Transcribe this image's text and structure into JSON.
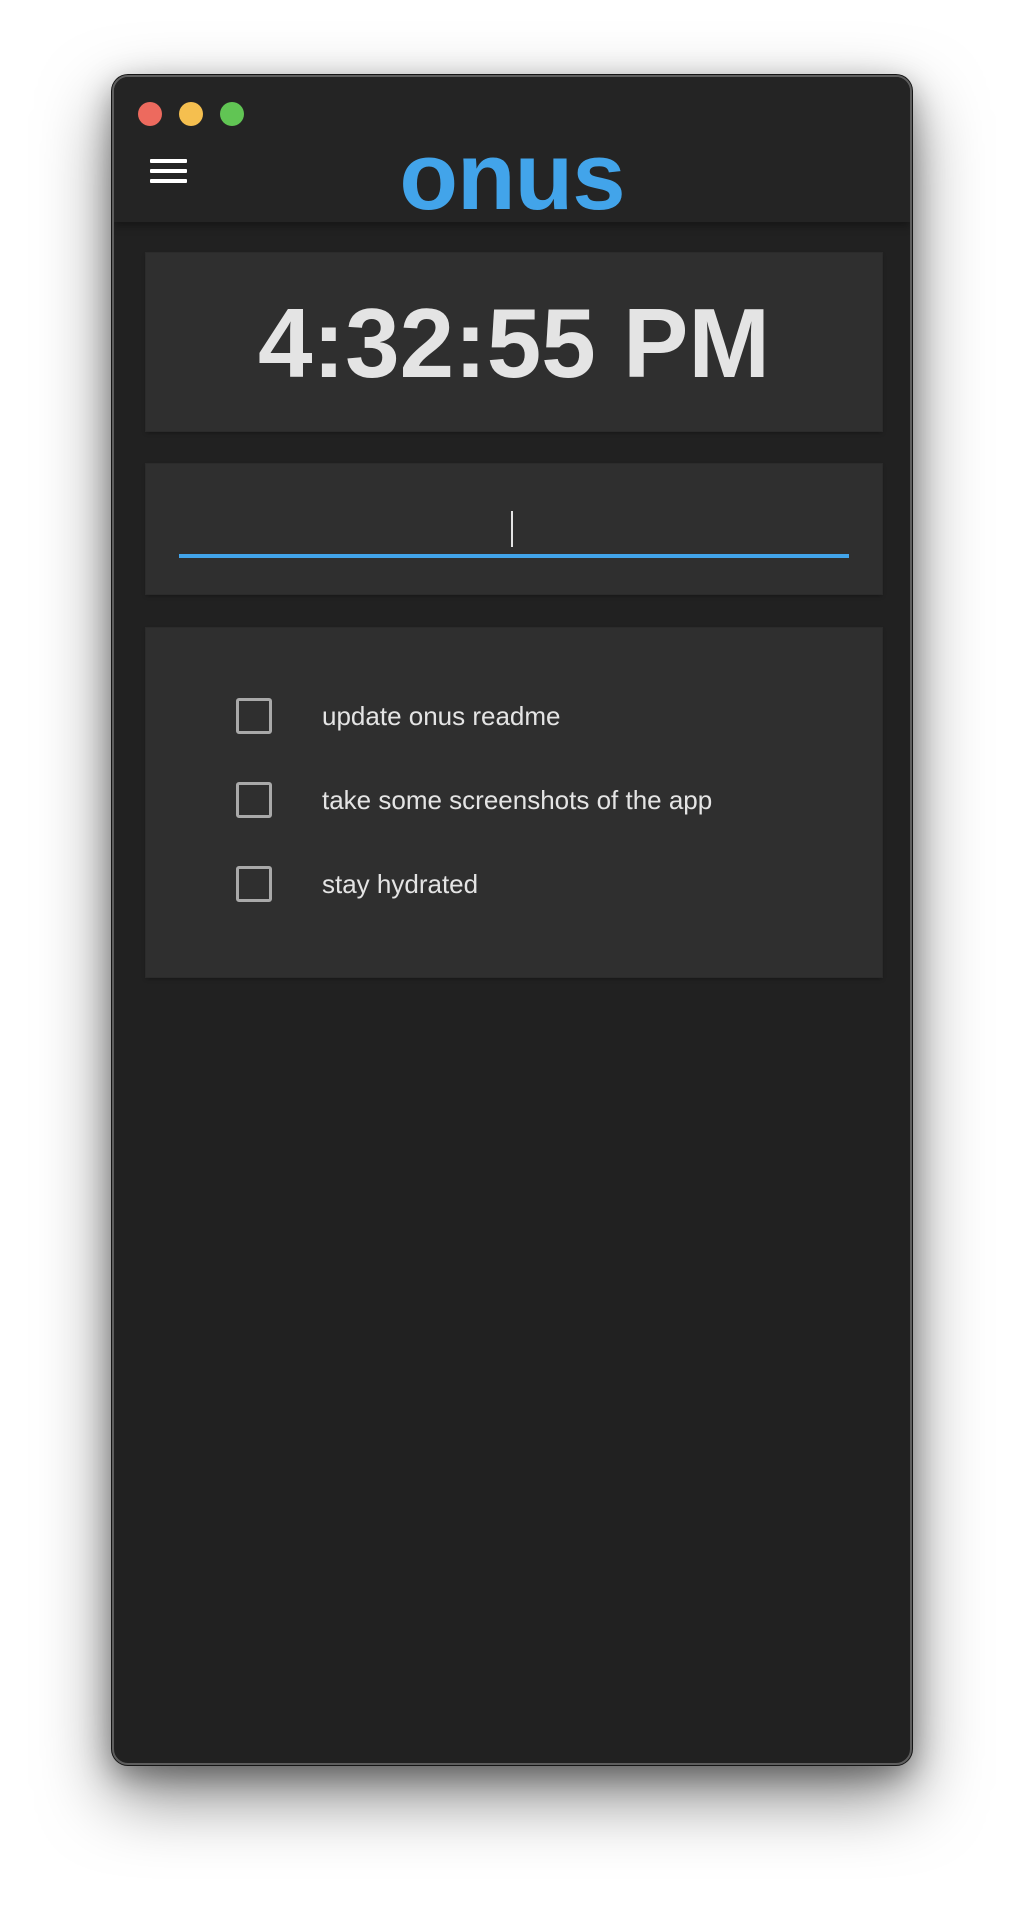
{
  "window": {
    "traffic_lights": {
      "close_color": "#ed6a5e",
      "minimize_color": "#f5bf4f",
      "maximize_color": "#61c554"
    }
  },
  "header": {
    "menu_icon": "hamburger-menu-icon",
    "title": "onus",
    "title_color": "#42a4ea"
  },
  "clock": {
    "time": "4:32:55 PM"
  },
  "task_input": {
    "value": "",
    "placeholder": "",
    "underline_color": "#42a4ea"
  },
  "todos": [
    {
      "label": "update onus readme",
      "checked": false
    },
    {
      "label": "take some screenshots of the app",
      "checked": false
    },
    {
      "label": "stay hydrated",
      "checked": false
    }
  ],
  "theme": {
    "background": "#212121",
    "card": "#2f2f2f",
    "text": "#e4e4e4"
  }
}
